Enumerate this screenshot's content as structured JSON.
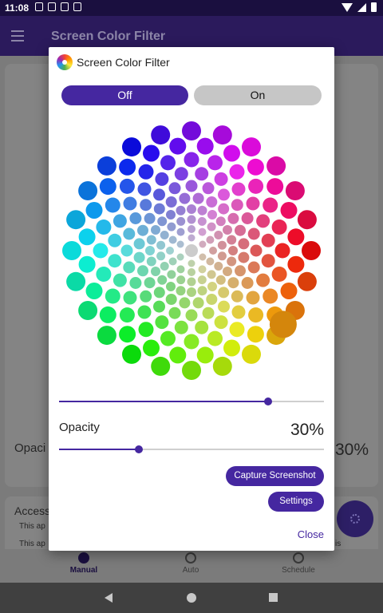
{
  "statusbar": {
    "time": "11:08",
    "icons": [
      "notification-icon",
      "notification-icon",
      "notification-icon",
      "notification-icon"
    ]
  },
  "appbar": {
    "title": "Screen Color Filter",
    "menu_icon": "menu-icon"
  },
  "background": {
    "opacity_label": "Opaci",
    "opacity_value": "30%",
    "access_title": "Access",
    "line1": "This ap",
    "line2": "This ap",
    "line2_end": "is"
  },
  "bottom_nav": {
    "items": [
      {
        "label": "Manual",
        "active": true
      },
      {
        "label": "Auto",
        "active": false
      },
      {
        "label": "Schedule",
        "active": false
      }
    ]
  },
  "dialog": {
    "title": "Screen Color Filter",
    "off_label": "Off",
    "on_label": "On",
    "selected_mode": "Off",
    "color_slider_value": 0.79,
    "opacity_label": "Opacity",
    "opacity_value": "30%",
    "opacity_slider_value": 0.3,
    "capture_label": "Capture Screenshot",
    "settings_label": "Settings",
    "close_label": "Close",
    "selected_color": "#d4860c",
    "accent_color": "#4527a0"
  }
}
